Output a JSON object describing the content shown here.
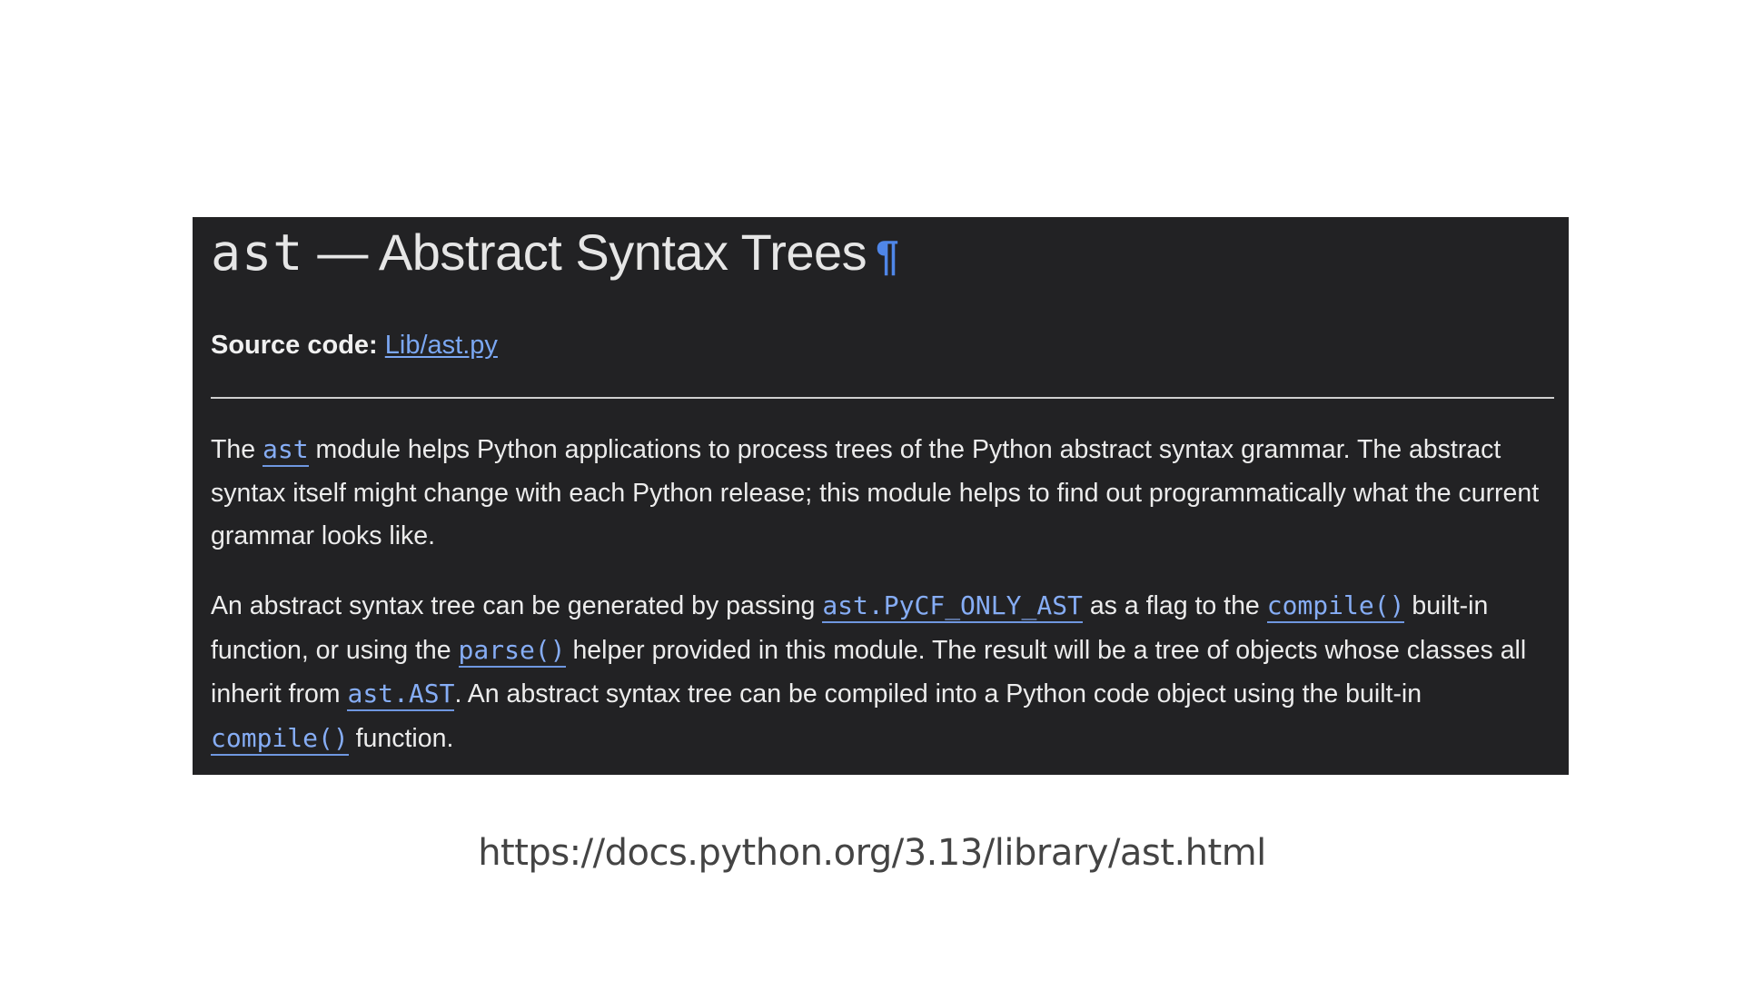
{
  "header": {
    "title_code": "ast",
    "title_text": " — Abstract Syntax Trees",
    "permalink_symbol": "¶"
  },
  "source": {
    "label": "Source code:",
    "link_text": "Lib/ast.py"
  },
  "paragraph1": {
    "t1": "The ",
    "link1": "ast",
    "t2": " module helps Python applications to process trees of the Python abstract syntax grammar. The ab­stract syntax itself might change with each Python release; this module helps to find out programmatically what the current grammar looks like."
  },
  "paragraph2": {
    "t1": "An abstract syntax tree can be generated by passing ",
    "link1": "ast.PyCF_ONLY_AST",
    "t2": " as a flag to the ",
    "link2": "compile()",
    "t3": " built-in function, or using the ",
    "link3": "parse()",
    "t4": " helper provided in this module. The result will be a tree of objects whose classes all inherit from ",
    "link4": "ast.AST",
    "t5": ". An abstract syntax tree can be compiled into a Python code object using the built-in ",
    "link5": "compile()",
    "t6": " function."
  },
  "caption": {
    "url": "https://docs.python.org/3.13/library/ast.html"
  },
  "colors": {
    "panel_bg": "#222224",
    "link": "#7ba7f2",
    "text": "#ececec"
  }
}
